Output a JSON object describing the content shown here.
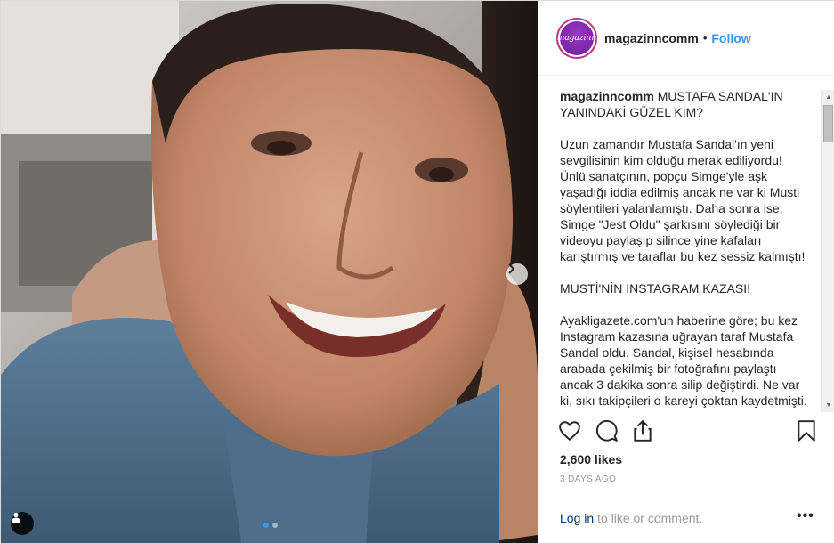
{
  "post": {
    "username": "magazinncomm",
    "avatar_text": "magazinn",
    "separator": "•",
    "follow_label": "Follow",
    "caption_title": "MUSTAFA SANDAL'IN YANINDAKİ GÜZEL KİM?",
    "paragraphs": [
      "Uzun zamandır Mustafa Sandal'ın yeni sevgilisinin kim olduğu merak ediliyordu! Ünlü sanatçının, popçu Simge'yle aşk yaşadığı iddia edilmiş ancak ne var ki Musti söylentileri yalanlamıştı. Daha sonra ise, Simge \"Jest Oldu\" şarkısını söylediği bir videoyu paylaşıp silince yine kafaları karıştırmış ve taraflar bu kez sessiz kalmıştı!",
      "MUSTİ'NİN INSTAGRAM KAZASI!",
      "Ayakligazete.com'un haberine göre; bu kez Instagram kazasına uğrayan taraf Mustafa Sandal oldu. Sandal, kişisel hesabında arabada çekilmiş bir fotoğrafını paylaştı ancak 3 dakika sonra silip değiştirdi. Ne var ki, sıkı takipçileri o kareyi çoktan kaydetmişti."
    ],
    "likes": "2,600 likes",
    "time": "3 DAYS AGO",
    "login_link": "Log in",
    "login_rest": " to like or comment.",
    "more_label": "•••"
  },
  "carousel": {
    "slides": 2,
    "active_index": 0
  },
  "colors": {
    "link": "#3897f0",
    "text": "#262626",
    "muted": "#999999",
    "login": "#003569"
  },
  "icons": [
    "heart-icon",
    "comment-icon",
    "share-icon",
    "bookmark-icon",
    "chevron-right-icon",
    "user-tag-icon"
  ]
}
